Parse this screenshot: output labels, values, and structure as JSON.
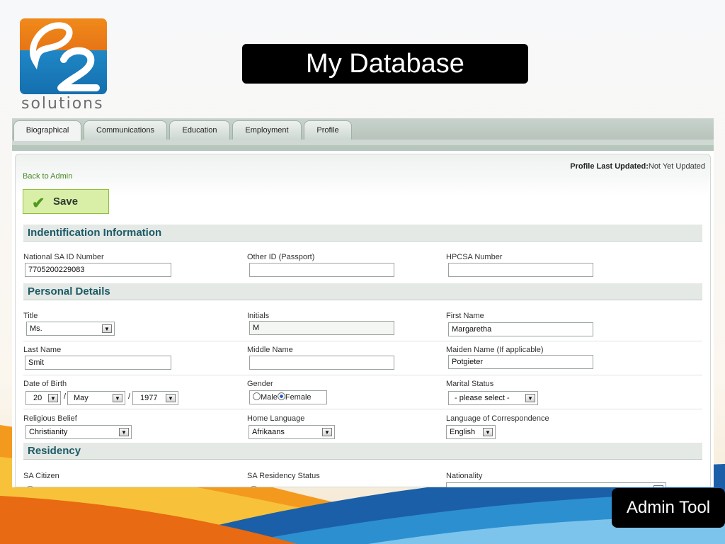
{
  "slide": {
    "title": "My Database",
    "footer_label": "Admin Tool",
    "logo_text": "solutions",
    "logo_mark": "e2"
  },
  "tabs": [
    "Biographical",
    "Communications",
    "Education",
    "Employment",
    "Profile"
  ],
  "header": {
    "back_link": "Back to Admin",
    "last_updated_label": "Profile Last Updated:",
    "last_updated_value": "Not Yet Updated",
    "save_label": "Save"
  },
  "sections": {
    "identification": "Indentification Information",
    "personal": "Personal Details",
    "residency": "Residency"
  },
  "identification": {
    "national_id_label": "National SA ID Number",
    "national_id_value": "7705200229083",
    "other_id_label": "Other ID (Passport)",
    "other_id_value": "",
    "hpcsa_label": "HPCSA Number",
    "hpcsa_value": ""
  },
  "personal": {
    "title_label": "Title",
    "title_value": "Ms.",
    "initials_label": "Initials",
    "initials_value": "M",
    "first_name_label": "First Name",
    "first_name_value": "Margaretha",
    "last_name_label": "Last Name",
    "last_name_value": "Smit",
    "middle_name_label": "Middle Name",
    "middle_name_value": "",
    "maiden_name_label": "Maiden Name (If applicable)",
    "maiden_name_value": "Potgieter",
    "dob_label": "Date of Birth",
    "dob_day": "20",
    "dob_month": "May",
    "dob_year": "1977",
    "dob_separator": "/",
    "gender_label": "Gender",
    "gender_male": "Male",
    "gender_female": "Female",
    "marital_label": "Marital Status",
    "marital_value": "- please select -",
    "religion_label": "Religious Belief",
    "religion_value": "Christianity",
    "home_language_label": "Home Language",
    "home_language_value": "Afrikaans",
    "correspondence_label": "Language of Correspondence",
    "correspondence_value": "English"
  },
  "residency": {
    "citizen_label": "SA Citizen",
    "status_label": "SA Residency Status",
    "nationality_label": "Nationality"
  },
  "colors": {
    "section_title": "#1d5a66",
    "save_bg": "#d9efa8",
    "link": "#4a8a2a",
    "logo_orange": "#f08a1a",
    "logo_blue": "#1f87c6"
  }
}
